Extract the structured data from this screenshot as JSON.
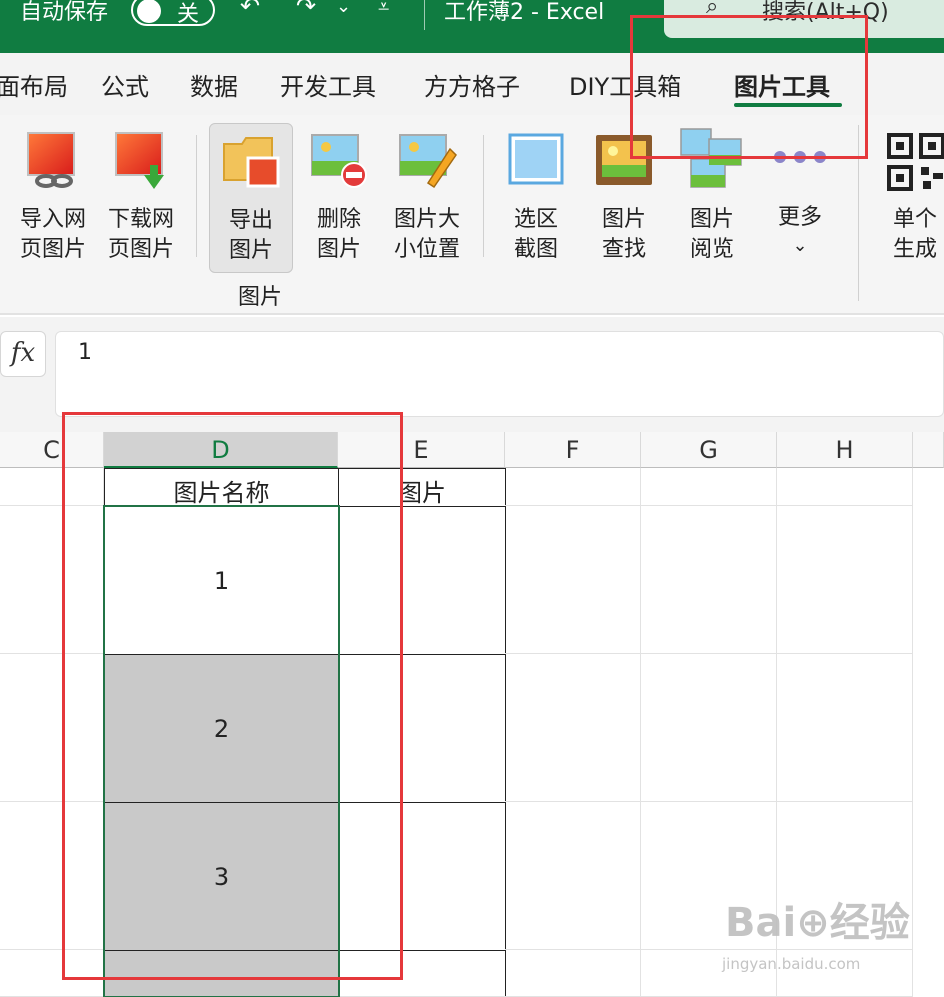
{
  "titlebar": {
    "autosave_label": "自动保存",
    "toggle_state": "关",
    "undo_icon": "↶",
    "redo_icon": "↷",
    "dropdown_icon": "⌄",
    "customize_icon": "⩡",
    "doc_title": "工作薄2  -  Excel",
    "search_icon": "⌕",
    "search_placeholder": "搜索(Alt+Q)"
  },
  "tabs": [
    {
      "label": "面布局"
    },
    {
      "label": "公式"
    },
    {
      "label": "数据"
    },
    {
      "label": "开发工具"
    },
    {
      "label": "方方格子"
    },
    {
      "label": "DIY工具箱"
    },
    {
      "label": "图片工具",
      "active": true
    }
  ],
  "ribbon": {
    "buttons": [
      {
        "line1": "导入网",
        "line2": "页图片",
        "icon": "import-web-image-icon"
      },
      {
        "line1": "下载网",
        "line2": "页图片",
        "icon": "download-web-image-icon"
      },
      {
        "line1": "导出",
        "line2": "图片",
        "icon": "export-image-icon"
      },
      {
        "line1": "删除",
        "line2": "图片",
        "icon": "delete-image-icon"
      },
      {
        "line1": "图片大",
        "line2": "小位置",
        "icon": "image-size-icon"
      },
      {
        "line1": "选区",
        "line2": "截图",
        "icon": "screenshot-icon"
      },
      {
        "line1": "图片",
        "line2": "查找",
        "icon": "image-find-icon"
      },
      {
        "line1": "图片",
        "line2": "阅览",
        "icon": "image-browse-icon"
      },
      {
        "line1": "更多",
        "line2": "⌄",
        "icon": "more-icon"
      },
      {
        "line1": "单个",
        "line2": "生成",
        "icon": "qr-code-icon"
      }
    ],
    "group_label": "图片"
  },
  "formula_bar": {
    "fx_label": "fx",
    "value": "1"
  },
  "grid": {
    "columns": [
      "C",
      "D",
      "E",
      "F",
      "G",
      "H"
    ],
    "header_row": {
      "d": "图片名称",
      "e": "图片"
    },
    "rows": [
      {
        "d": "1"
      },
      {
        "d": "2"
      },
      {
        "d": "3"
      },
      {
        "d": ""
      }
    ]
  },
  "watermark": {
    "text": "Bai⊕经验",
    "sub": "jingyan.baidu.com"
  }
}
